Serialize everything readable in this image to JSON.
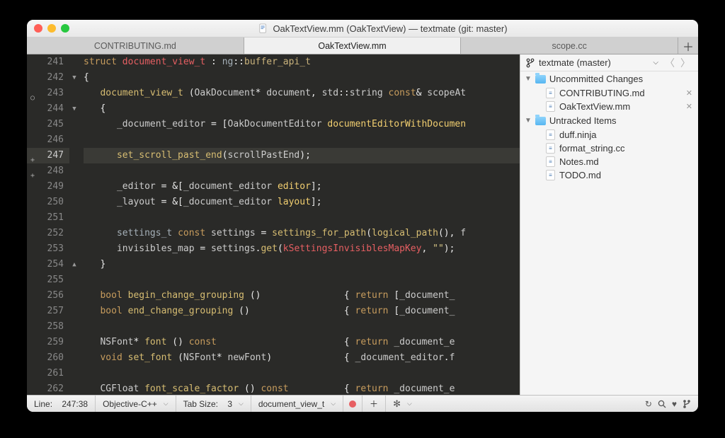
{
  "window": {
    "title": "OakTextView.mm (OakTextView) — textmate (git: master)"
  },
  "tabs": [
    {
      "label": "CONTRIBUTING.md",
      "active": false
    },
    {
      "label": "OakTextView.mm",
      "active": true
    },
    {
      "label": "scope.cc",
      "active": false
    }
  ],
  "gutter": {
    "start": 241,
    "current": 247,
    "fold_down": [
      242,
      244
    ],
    "fold_up": [
      254
    ],
    "marks": {
      "243": "○",
      "247": "+",
      "248": "+"
    }
  },
  "code": {
    "lines": [
      {
        "n": 241,
        "html": "<span class='kw'>struct</span> <span class='id'>document_view_t</span> <span class='punc'>:</span> <span class='type'>ng</span><span class='punc'>::</span><span class='ns'>buffer_api_t</span>"
      },
      {
        "n": 242,
        "html": "<span class='punc'>{</span>"
      },
      {
        "n": 243,
        "html": "   <span class='fn'>document_view_t</span> <span class='punc'>(</span>OakDocument<span class='punc'>*</span> document<span class='punc'>,</span> std<span class='punc'>::</span>string <span class='kw'>const</span><span class='punc'>&amp;</span> scopeAt"
      },
      {
        "n": 244,
        "html": "   <span class='punc'>{</span>"
      },
      {
        "n": 245,
        "html": "      _document_editor <span class='punc'>=</span> <span class='punc'>[</span>OakDocumentEditor <span class='obj'>documentEditorWithDocumen</span>"
      },
      {
        "n": 246,
        "html": ""
      },
      {
        "n": 247,
        "html": "      <span class='fn'>set_scroll_past_end</span><span class='punc'>(</span>scrollPastEnd<span class='punc'>)</span><span class='punc'>;</span>"
      },
      {
        "n": 248,
        "html": ""
      },
      {
        "n": 249,
        "html": "      _editor <span class='punc'>=</span> <span class='punc'>&amp;[</span>_document_editor <span class='obj'>editor</span><span class='punc'>];</span>"
      },
      {
        "n": 250,
        "html": "      _layout <span class='punc'>=</span> <span class='punc'>&amp;[</span>_document_editor <span class='obj'>layout</span><span class='punc'>];</span>"
      },
      {
        "n": 251,
        "html": ""
      },
      {
        "n": 252,
        "html": "      <span class='type'>settings_t</span> <span class='kw'>const</span> settings <span class='punc'>=</span> <span class='fn'>settings_for_path</span><span class='punc'>(</span><span class='fn'>logical_path</span><span class='punc'>(</span><span class='punc'>)</span><span class='punc'>,</span> f"
      },
      {
        "n": 253,
        "html": "      invisibles_map <span class='punc'>=</span> settings<span class='punc'>.</span><span class='fn'>get</span><span class='punc'>(</span><span class='id'>kSettingsInvisiblesMapKey</span><span class='punc'>,</span> <span class='str'>\"\"</span><span class='punc'>)</span><span class='punc'>;</span>"
      },
      {
        "n": 254,
        "html": "   <span class='punc'>}</span>"
      },
      {
        "n": 255,
        "html": ""
      },
      {
        "n": 256,
        "html": "   <span class='kw'>bool</span> <span class='fn'>begin_change_grouping</span> <span class='punc'>(</span><span class='punc'>)</span>               <span class='punc'>{</span> <span class='kw'>return</span> <span class='punc'>[</span>_document_"
      },
      {
        "n": 257,
        "html": "   <span class='kw'>bool</span> <span class='fn'>end_change_grouping</span> <span class='punc'>(</span><span class='punc'>)</span>                 <span class='punc'>{</span> <span class='kw'>return</span> <span class='punc'>[</span>_document_"
      },
      {
        "n": 258,
        "html": ""
      },
      {
        "n": 259,
        "html": "   NSFont<span class='punc'>*</span> <span class='fn'>font</span> <span class='punc'>(</span><span class='punc'>)</span> <span class='kw'>const</span>                       <span class='punc'>{</span> <span class='kw'>return</span> _document_e"
      },
      {
        "n": 260,
        "html": "   <span class='kw'>void</span> <span class='fn'>set_font</span> <span class='punc'>(</span>NSFont<span class='punc'>*</span> newFont<span class='punc'>)</span>             <span class='punc'>{</span> _document_editor<span class='punc'>.</span>f"
      },
      {
        "n": 261,
        "html": ""
      },
      {
        "n": 262,
        "html": "   CGFloat <span class='fn'>font_scale_factor</span> <span class='punc'>(</span><span class='punc'>)</span> <span class='kw'>const</span>          <span class='punc'>{</span> <span class='kw'>return</span> _document_e"
      }
    ]
  },
  "sidebar": {
    "repo": "textmate (master)",
    "sections": [
      {
        "title": "Uncommitted Changes",
        "items": [
          {
            "name": "CONTRIBUTING.md",
            "closable": true
          },
          {
            "name": "OakTextView.mm",
            "closable": true
          }
        ]
      },
      {
        "title": "Untracked Items",
        "items": [
          {
            "name": "duff.ninja"
          },
          {
            "name": "format_string.cc"
          },
          {
            "name": "Notes.md"
          },
          {
            "name": "TODO.md"
          }
        ]
      }
    ]
  },
  "status": {
    "line_label": "Line:",
    "position": "247:38",
    "language": "Objective-C++",
    "tabsize_label": "Tab Size:",
    "tabsize": "3",
    "symbol": "document_view_t"
  }
}
